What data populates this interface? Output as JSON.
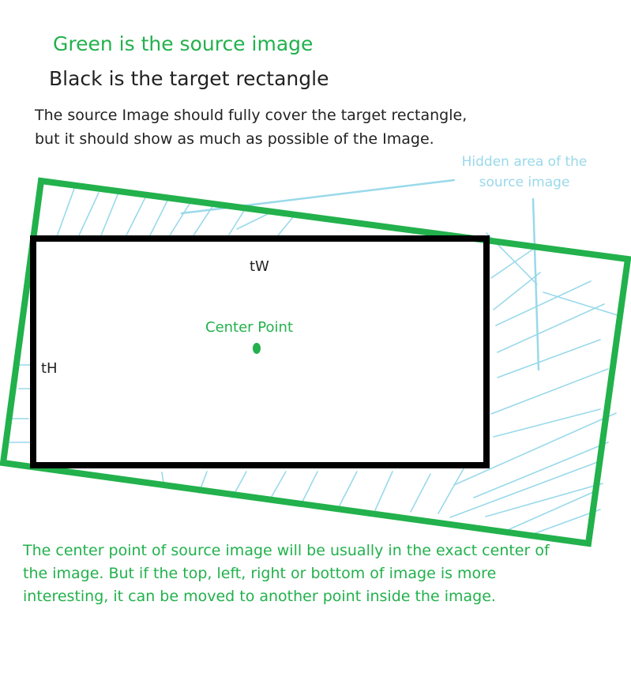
{
  "legend": {
    "green_label": "Green is the source image",
    "black_label": "Black is the target rectangle"
  },
  "requirement": {
    "line1": "The source Image should fully cover the target rectangle,",
    "line2": "but it should show as much as possible of the Image."
  },
  "hidden_area_note": {
    "line1": "Hidden area of the",
    "line2": "source image"
  },
  "labels": {
    "width": "tW",
    "height": "tH",
    "center_point": "Center Point"
  },
  "footer_note": {
    "line1": "The center point of source image will be usually in the exact center of",
    "line2": "the image. But if the top, left, right or bottom of image is more",
    "line3": "interesting, it can be moved to another point inside the image."
  },
  "colors": {
    "source_green": "#22b14c",
    "target_black": "#000000",
    "hatch_blue": "#99d9ea",
    "text_dark": "#222222"
  }
}
